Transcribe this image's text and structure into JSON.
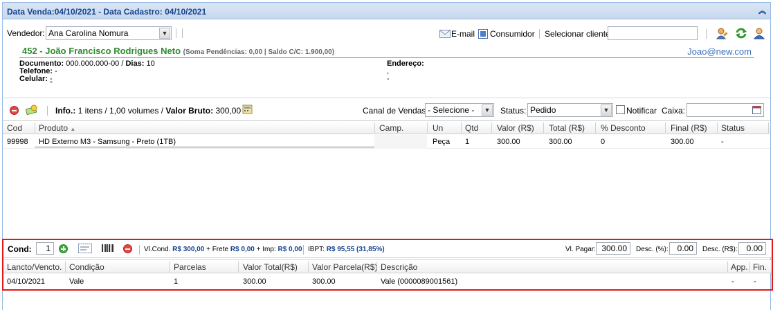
{
  "header": {
    "title": "Data Venda:04/10/2021 - Data Cadastro: 04/10/2021",
    "collapse_icon": "double-chevron-up-icon"
  },
  "vendor": {
    "label": "Vendedor:",
    "selected": "Ana Carolina Nomura",
    "email_label": "E-mail",
    "consumer_label": "Consumidor",
    "select_client_label": "Selecionar cliente:",
    "select_client_value": ""
  },
  "client": {
    "name": "452 - João Francisco Rodrigues Neto",
    "pendings": "(Soma Pendências: 0,00 | Saldo C/C: 1.900,00)",
    "email": "Joao@new.com",
    "document_label": "Documento:",
    "document_value": "000.000.000-00 /",
    "days_label": "Dias:",
    "days_value": "10",
    "phone_label": "Telefone:",
    "phone_value": "-",
    "cell_label": "Celular:",
    "cell_value": "-",
    "address_label": "Endereço:",
    "address_line1": ",",
    "address_line2": "-"
  },
  "toolbar": {
    "info_label": "Info.:",
    "info_text": "1 itens / 1,00 volumes /",
    "gross_label": "Valor Bruto:",
    "gross_value": "300,00",
    "sales_channel_label": "Canal de Vendas:",
    "sales_channel_value": "- Selecione -",
    "status_label": "Status:",
    "status_value": "Pedido",
    "notify_label": "Notificar",
    "cashier_label": "Caixa:",
    "cashier_value": ""
  },
  "products": {
    "columns": [
      "Cod",
      "Produto",
      "Camp.",
      "Un",
      "Qtd",
      "Valor (R$)",
      "Total (R$)",
      "% Desconto",
      "Final (R$)",
      "Status"
    ],
    "sort_indicator": "▲",
    "rows": [
      {
        "cod": "99998",
        "produto": "HD Externo M3 - Samsung - Preto (1TB)",
        "camp": "",
        "un": "Peça",
        "qtd": "1",
        "valor": "300.00",
        "total": "300.00",
        "desconto": "0",
        "final": "300.00",
        "status": "-"
      }
    ]
  },
  "payment": {
    "cond_label": "Cond:",
    "cond_value": "1",
    "vlcond_label": "Vl.Cond.",
    "vlcond_value": "R$ 300,00",
    "frete_label": "+ Frete",
    "frete_value": "R$ 0,00",
    "imp_label": "+ Imp:",
    "imp_value": "R$ 0,00",
    "ibpt_label": "IBPT:",
    "ibpt_value": "R$ 95,55 (31,85%)",
    "vl_pagar_label": "Vl. Pagar:",
    "vl_pagar_value": "300.00",
    "desc_pct_label": "Desc. (%):",
    "desc_pct_value": "0.00",
    "desc_rs_label": "Desc. (R$):",
    "desc_rs_value": "0.00",
    "columns": [
      "Lancto/Vencto.",
      "Condição",
      "Parcelas",
      "Valor Total(R$)",
      "Valor Parcela(R$)",
      "Descrição",
      "App.",
      "Fin."
    ],
    "rows": [
      {
        "lancto": "04/10/2021",
        "condicao": "Vale",
        "parcelas": "1",
        "total": "300.00",
        "parcela": "300.00",
        "descricao": "Vale (0000089001561)",
        "app": "-",
        "fin": "-"
      }
    ]
  }
}
